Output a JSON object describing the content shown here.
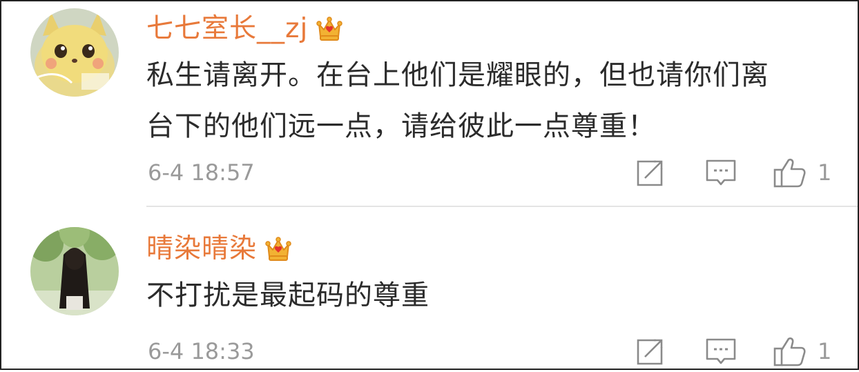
{
  "comments": [
    {
      "username": "七七室长__zj",
      "avatar": "pikachu-avatar",
      "badge": "crown-icon",
      "text": [
        "私生请离开。在台上他们是耀眼的，但也请你们离",
        "台下的他们远一点，请给彼此一点尊重！"
      ],
      "time": "6-4 18:57",
      "likes": "1"
    },
    {
      "username": "晴染晴染",
      "avatar": "girl-in-forest-avatar",
      "badge": "crown-icon",
      "text": [
        "不打扰是最起码的尊重"
      ],
      "time": "6-4 18:33",
      "likes": "1"
    }
  ],
  "colors": {
    "username": "#e8793a",
    "text": "#2b2b2b",
    "meta": "#9a9a9a",
    "icon": "#8a8a8a",
    "crown": "#f0a623"
  }
}
